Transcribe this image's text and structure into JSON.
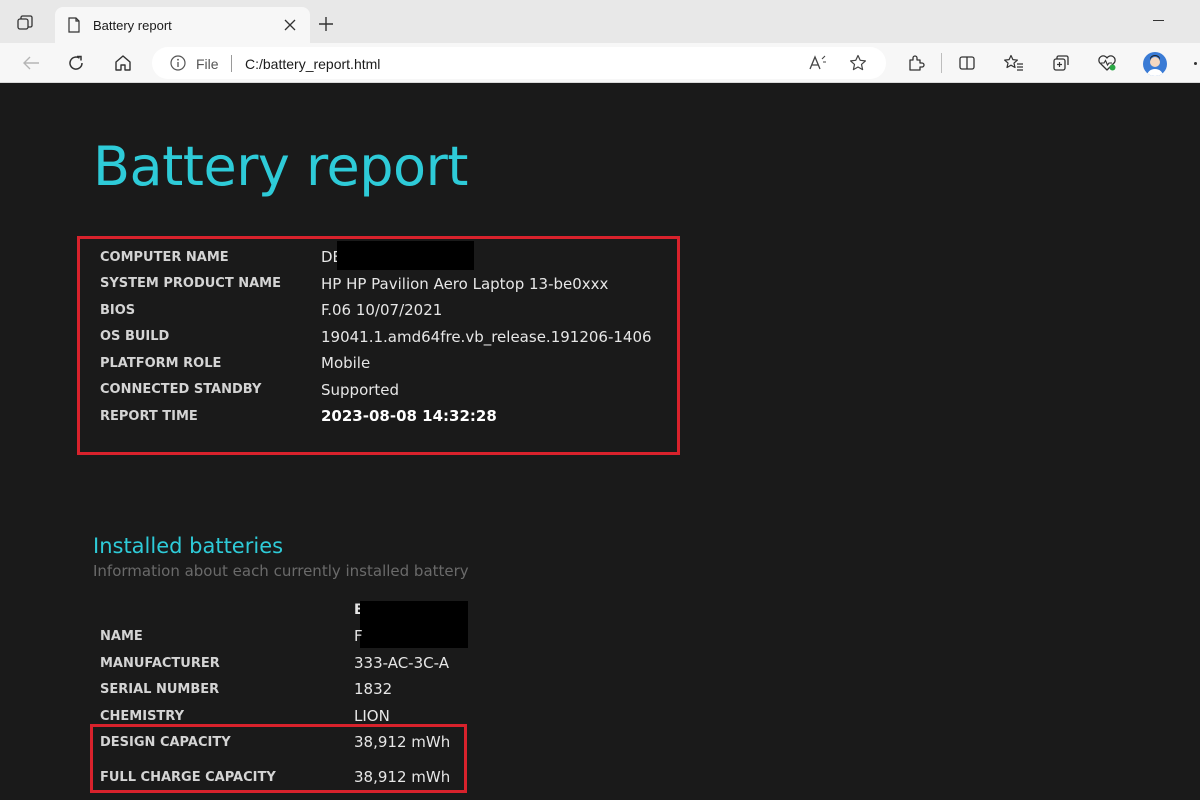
{
  "browser": {
    "tab_title": "Battery report",
    "address_scheme": "File",
    "address_url": "C:/battery_report.html",
    "icons": [
      "workspaces-icon",
      "page-icon",
      "close-icon",
      "new-tab-icon",
      "back-icon",
      "refresh-icon",
      "home-icon",
      "info-icon",
      "read-aloud-icon",
      "favorite-star-icon",
      "extensions-icon",
      "split-screen-icon",
      "favorites-icon",
      "collections-icon",
      "browser-essentials-icon",
      "profile-avatar",
      "more-icon"
    ]
  },
  "report": {
    "title": "Battery report",
    "system_info": [
      {
        "key": "COMPUTER NAME",
        "value": "DE"
      },
      {
        "key": "SYSTEM PRODUCT NAME",
        "value": "HP HP Pavilion Aero Laptop 13-be0xxx"
      },
      {
        "key": "BIOS",
        "value": "F.06 10/07/2021"
      },
      {
        "key": "OS BUILD",
        "value": "19041.1.amd64fre.vb_release.191206-1406"
      },
      {
        "key": "PLATFORM ROLE",
        "value": "Mobile"
      },
      {
        "key": "CONNECTED STANDBY",
        "value": "Supported"
      },
      {
        "key": "REPORT TIME",
        "value": "2023-08-08  14:32:28"
      }
    ],
    "installed_batteries": {
      "title": "Installed batteries",
      "subtitle": "Information about each currently installed battery",
      "column_header": "B",
      "rows": [
        {
          "key": "NAME",
          "value": "F"
        },
        {
          "key": "MANUFACTURER",
          "value": "333-AC-3C-A"
        },
        {
          "key": "SERIAL NUMBER",
          "value": "1832"
        },
        {
          "key": "CHEMISTRY",
          "value": "LION"
        },
        {
          "key": "DESIGN CAPACITY",
          "value": "38,912 mWh"
        },
        {
          "key": "FULL CHARGE CAPACITY",
          "value": "38,912 mWh"
        }
      ]
    }
  },
  "colors": {
    "accent": "#2ecbd8",
    "highlight_box": "#d8222c",
    "background": "#1a1a1a"
  }
}
